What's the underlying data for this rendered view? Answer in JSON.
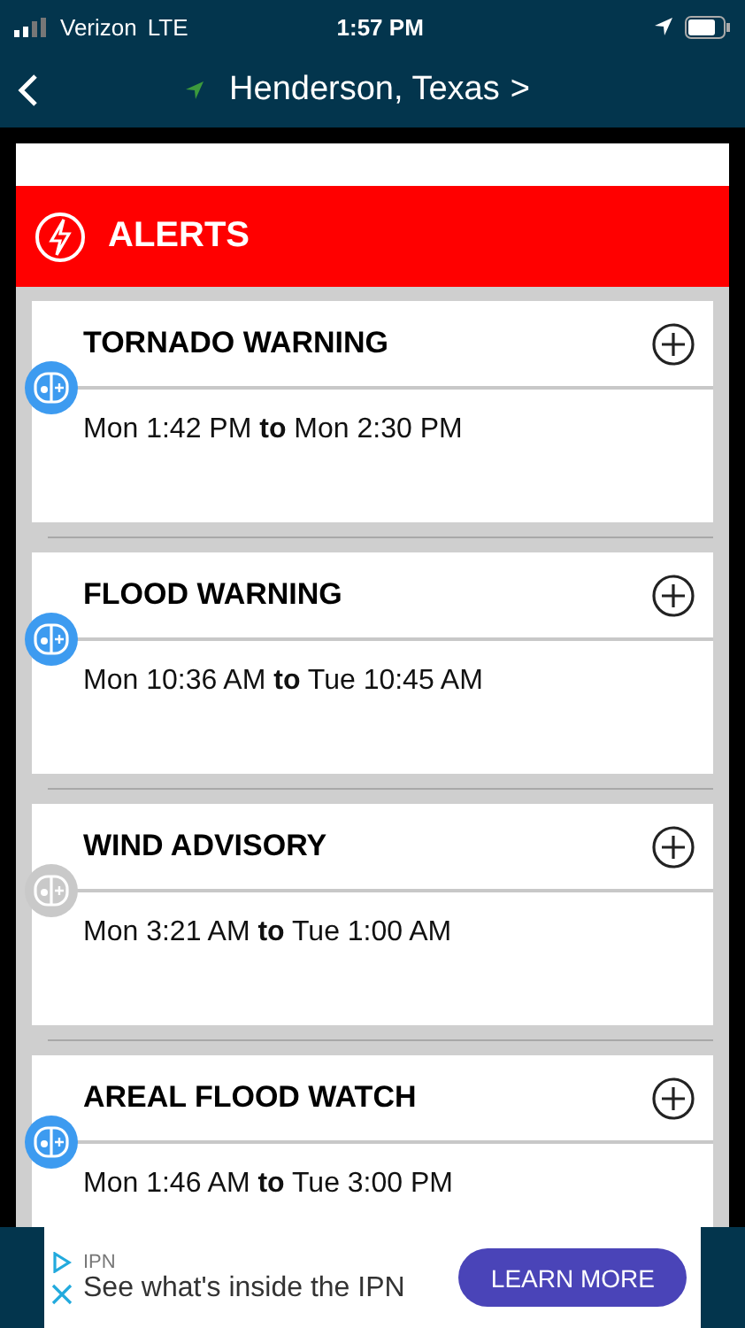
{
  "status_bar": {
    "carrier": "Verizon",
    "network": "LTE",
    "time": "1:57 PM"
  },
  "nav": {
    "location": "Henderson, Texas",
    "chevron": ">"
  },
  "header": {
    "title": "ALERTS"
  },
  "alerts": [
    {
      "title": "TORNADO WARNING",
      "period": "Mon 1:42 PM **to** Mon 2:30 PM",
      "active": true
    },
    {
      "title": "FLOOD WARNING",
      "period": "Mon 10:36 AM **to** Tue 10:45 AM",
      "active": true
    },
    {
      "title": "WIND ADVISORY",
      "period": "Mon 3:21 AM **to** Tue 1:00 AM",
      "active": false
    },
    {
      "title": "AREAL FLOOD WATCH",
      "period": "Mon 1:46 AM **to** Tue 3:00 PM",
      "active": true
    }
  ],
  "ad": {
    "sponsor": "IPN",
    "headline": "See what's inside the IPN",
    "button": "LEARN MORE"
  }
}
